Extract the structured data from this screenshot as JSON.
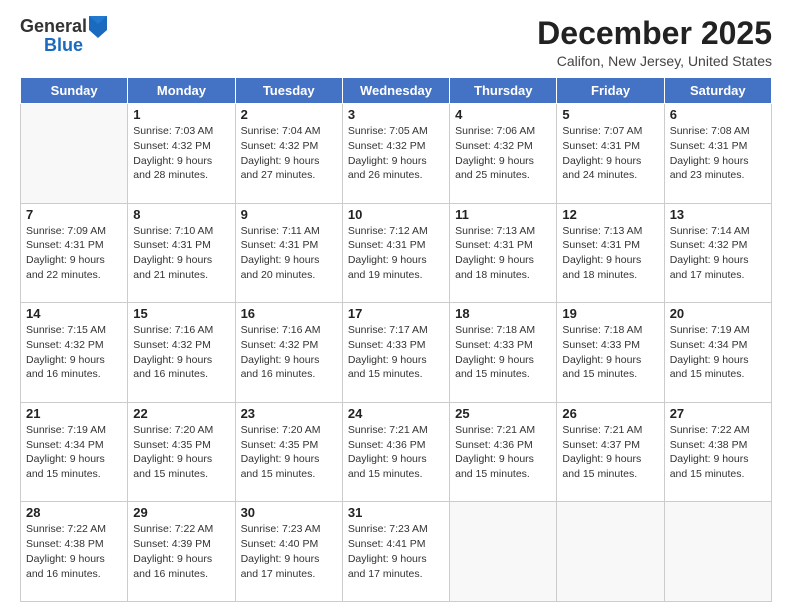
{
  "logo": {
    "general": "General",
    "blue": "Blue"
  },
  "title": "December 2025",
  "location": "Califon, New Jersey, United States",
  "headers": [
    "Sunday",
    "Monday",
    "Tuesday",
    "Wednesday",
    "Thursday",
    "Friday",
    "Saturday"
  ],
  "weeks": [
    [
      {
        "day": "",
        "sunrise": "",
        "sunset": "",
        "daylight": ""
      },
      {
        "day": "1",
        "sunrise": "Sunrise: 7:03 AM",
        "sunset": "Sunset: 4:32 PM",
        "daylight": "Daylight: 9 hours and 28 minutes."
      },
      {
        "day": "2",
        "sunrise": "Sunrise: 7:04 AM",
        "sunset": "Sunset: 4:32 PM",
        "daylight": "Daylight: 9 hours and 27 minutes."
      },
      {
        "day": "3",
        "sunrise": "Sunrise: 7:05 AM",
        "sunset": "Sunset: 4:32 PM",
        "daylight": "Daylight: 9 hours and 26 minutes."
      },
      {
        "day": "4",
        "sunrise": "Sunrise: 7:06 AM",
        "sunset": "Sunset: 4:32 PM",
        "daylight": "Daylight: 9 hours and 25 minutes."
      },
      {
        "day": "5",
        "sunrise": "Sunrise: 7:07 AM",
        "sunset": "Sunset: 4:31 PM",
        "daylight": "Daylight: 9 hours and 24 minutes."
      },
      {
        "day": "6",
        "sunrise": "Sunrise: 7:08 AM",
        "sunset": "Sunset: 4:31 PM",
        "daylight": "Daylight: 9 hours and 23 minutes."
      }
    ],
    [
      {
        "day": "7",
        "sunrise": "Sunrise: 7:09 AM",
        "sunset": "Sunset: 4:31 PM",
        "daylight": "Daylight: 9 hours and 22 minutes."
      },
      {
        "day": "8",
        "sunrise": "Sunrise: 7:10 AM",
        "sunset": "Sunset: 4:31 PM",
        "daylight": "Daylight: 9 hours and 21 minutes."
      },
      {
        "day": "9",
        "sunrise": "Sunrise: 7:11 AM",
        "sunset": "Sunset: 4:31 PM",
        "daylight": "Daylight: 9 hours and 20 minutes."
      },
      {
        "day": "10",
        "sunrise": "Sunrise: 7:12 AM",
        "sunset": "Sunset: 4:31 PM",
        "daylight": "Daylight: 9 hours and 19 minutes."
      },
      {
        "day": "11",
        "sunrise": "Sunrise: 7:13 AM",
        "sunset": "Sunset: 4:31 PM",
        "daylight": "Daylight: 9 hours and 18 minutes."
      },
      {
        "day": "12",
        "sunrise": "Sunrise: 7:13 AM",
        "sunset": "Sunset: 4:31 PM",
        "daylight": "Daylight: 9 hours and 18 minutes."
      },
      {
        "day": "13",
        "sunrise": "Sunrise: 7:14 AM",
        "sunset": "Sunset: 4:32 PM",
        "daylight": "Daylight: 9 hours and 17 minutes."
      }
    ],
    [
      {
        "day": "14",
        "sunrise": "Sunrise: 7:15 AM",
        "sunset": "Sunset: 4:32 PM",
        "daylight": "Daylight: 9 hours and 16 minutes."
      },
      {
        "day": "15",
        "sunrise": "Sunrise: 7:16 AM",
        "sunset": "Sunset: 4:32 PM",
        "daylight": "Daylight: 9 hours and 16 minutes."
      },
      {
        "day": "16",
        "sunrise": "Sunrise: 7:16 AM",
        "sunset": "Sunset: 4:32 PM",
        "daylight": "Daylight: 9 hours and 16 minutes."
      },
      {
        "day": "17",
        "sunrise": "Sunrise: 7:17 AM",
        "sunset": "Sunset: 4:33 PM",
        "daylight": "Daylight: 9 hours and 15 minutes."
      },
      {
        "day": "18",
        "sunrise": "Sunrise: 7:18 AM",
        "sunset": "Sunset: 4:33 PM",
        "daylight": "Daylight: 9 hours and 15 minutes."
      },
      {
        "day": "19",
        "sunrise": "Sunrise: 7:18 AM",
        "sunset": "Sunset: 4:33 PM",
        "daylight": "Daylight: 9 hours and 15 minutes."
      },
      {
        "day": "20",
        "sunrise": "Sunrise: 7:19 AM",
        "sunset": "Sunset: 4:34 PM",
        "daylight": "Daylight: 9 hours and 15 minutes."
      }
    ],
    [
      {
        "day": "21",
        "sunrise": "Sunrise: 7:19 AM",
        "sunset": "Sunset: 4:34 PM",
        "daylight": "Daylight: 9 hours and 15 minutes."
      },
      {
        "day": "22",
        "sunrise": "Sunrise: 7:20 AM",
        "sunset": "Sunset: 4:35 PM",
        "daylight": "Daylight: 9 hours and 15 minutes."
      },
      {
        "day": "23",
        "sunrise": "Sunrise: 7:20 AM",
        "sunset": "Sunset: 4:35 PM",
        "daylight": "Daylight: 9 hours and 15 minutes."
      },
      {
        "day": "24",
        "sunrise": "Sunrise: 7:21 AM",
        "sunset": "Sunset: 4:36 PM",
        "daylight": "Daylight: 9 hours and 15 minutes."
      },
      {
        "day": "25",
        "sunrise": "Sunrise: 7:21 AM",
        "sunset": "Sunset: 4:36 PM",
        "daylight": "Daylight: 9 hours and 15 minutes."
      },
      {
        "day": "26",
        "sunrise": "Sunrise: 7:21 AM",
        "sunset": "Sunset: 4:37 PM",
        "daylight": "Daylight: 9 hours and 15 minutes."
      },
      {
        "day": "27",
        "sunrise": "Sunrise: 7:22 AM",
        "sunset": "Sunset: 4:38 PM",
        "daylight": "Daylight: 9 hours and 15 minutes."
      }
    ],
    [
      {
        "day": "28",
        "sunrise": "Sunrise: 7:22 AM",
        "sunset": "Sunset: 4:38 PM",
        "daylight": "Daylight: 9 hours and 16 minutes."
      },
      {
        "day": "29",
        "sunrise": "Sunrise: 7:22 AM",
        "sunset": "Sunset: 4:39 PM",
        "daylight": "Daylight: 9 hours and 16 minutes."
      },
      {
        "day": "30",
        "sunrise": "Sunrise: 7:23 AM",
        "sunset": "Sunset: 4:40 PM",
        "daylight": "Daylight: 9 hours and 17 minutes."
      },
      {
        "day": "31",
        "sunrise": "Sunrise: 7:23 AM",
        "sunset": "Sunset: 4:41 PM",
        "daylight": "Daylight: 9 hours and 17 minutes."
      },
      {
        "day": "",
        "sunrise": "",
        "sunset": "",
        "daylight": ""
      },
      {
        "day": "",
        "sunrise": "",
        "sunset": "",
        "daylight": ""
      },
      {
        "day": "",
        "sunrise": "",
        "sunset": "",
        "daylight": ""
      }
    ]
  ]
}
